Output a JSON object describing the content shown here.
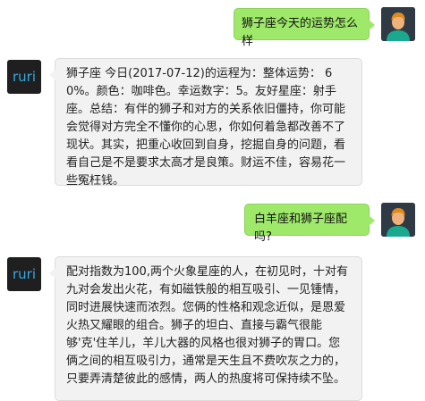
{
  "bot": {
    "logo_text": "ruri"
  },
  "messages": [
    {
      "sender": "user",
      "text": "狮子座今天的运势怎么样"
    },
    {
      "sender": "bot",
      "text": "狮子座 今日(2017-07-12)的运程为：整体运势： 60%。颜色：咖啡色。幸运数字：5。友好星座：射手座。总结：有伴的狮子和对方的关系依旧僵持，你可能会觉得对方完全不懂你的心思，你如何着急都改善不了现状。其实，把重心收回到自身，挖掘自身的问题，看看自己是不是要求太高才是良策。财运不佳，容易花一些冤枉钱。"
    },
    {
      "sender": "user",
      "text": "白羊座和狮子座配吗?"
    },
    {
      "sender": "bot",
      "text": "配对指数为100,两个火象星座的人，在初见时，十对有九对会发出火花，有如磁铁般的相互吸引、一见锺情，同时进展快速而浓烈。您俩的性格和观念近似，是恩爱火热又耀眼的组合。狮子的坦白、直接与霸气很能够'克'住羊儿，羊儿大器的风格也很对狮子的胃口。您俩之间的相互吸引力，通常是天生且不费吹灰之力的，只要弄清楚彼此的感情，两人的热度将可保持续不坠。"
    }
  ],
  "colors": {
    "user_bubble": "#9ee86a",
    "bot_bubble": "#f2f2f2",
    "bot_logo": "#36a9e1",
    "user_avatar_bg": "#2f3a45"
  }
}
